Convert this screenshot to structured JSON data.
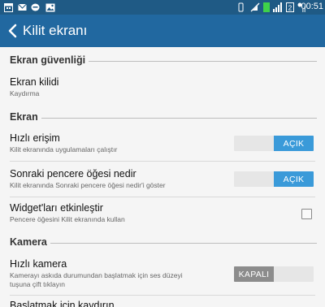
{
  "status_bar": {
    "time": "00:51",
    "left_icons": [
      "calendar-icon",
      "mail-icon",
      "chat-icon",
      "photo-icon"
    ],
    "right_icons": [
      "vibrate-icon",
      "no-sim-icon",
      "signal-icon",
      "data-icon",
      "wifi-signal-icon",
      "battery-icon"
    ]
  },
  "app_bar": {
    "title": "Kilit ekranı",
    "back_icon": "chevron-left-icon"
  },
  "sections": {
    "security": {
      "title": "Ekran güvenliği",
      "screen_lock": {
        "title": "Ekran kilidi",
        "subtitle": "Kaydırma"
      }
    },
    "screen": {
      "title": "Ekran",
      "quick_access": {
        "title": "Hızlı erişim",
        "subtitle": "Kilit ekranında uygulamaları çalıştır",
        "toggle": "AÇIK"
      },
      "next_window": {
        "title": "Sonraki pencere öğesi nedir",
        "subtitle": "Kilit ekranında Sonraki pencere öğesi nedir'i göster",
        "toggle": "AÇIK"
      },
      "widgets": {
        "title": "Widget'ları etkinleştir",
        "subtitle": "Pencere öğesini Kilit ekranında kullan",
        "checked": false
      }
    },
    "camera": {
      "title": "Kamera",
      "quick_camera": {
        "title": "Hızlı kamera",
        "subtitle_line1": "Kamerayı askıda durumundan başlatmak için ses düzeyi",
        "subtitle_line2": "tuşuna çift tıklayın",
        "toggle": "KAPALI"
      },
      "swipe_to_start": {
        "title": "Başlatmak için kaydırın"
      }
    }
  },
  "colors": {
    "status_bar": "#1f5a85",
    "app_bar": "#2168a0",
    "toggle_on": "#3a9ad9",
    "toggle_off": "#8c8c8c",
    "background": "#f5f5f5"
  }
}
